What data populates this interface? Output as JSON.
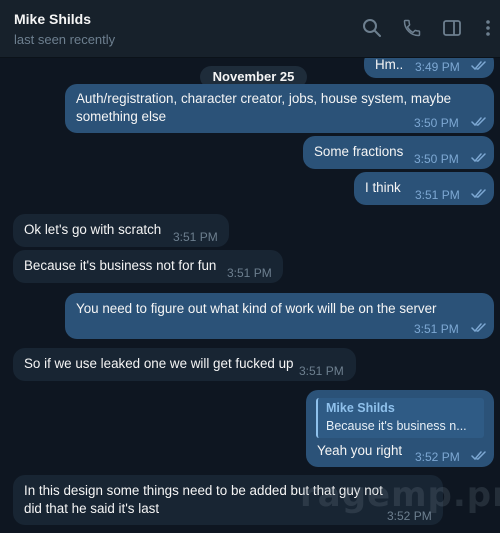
{
  "header": {
    "contact_name": "Mike Shilds",
    "status": "last seen recently"
  },
  "date_separator": "November 25",
  "messages": [
    {
      "text": "Hm..",
      "time": "3:49 PM"
    },
    {
      "text": "Auth/registration, character creator, jobs, house system, maybe something else",
      "time": "3:50 PM"
    },
    {
      "text": "Some fractions",
      "time": "3:50 PM"
    },
    {
      "text": "I think",
      "time": "3:51 PM"
    },
    {
      "text": "Ok let's go with scratch",
      "time": "3:51 PM"
    },
    {
      "text": "Because it's business not for fun",
      "time": "3:51 PM"
    },
    {
      "text": "You need to figure out what kind of work will be on the server",
      "time": "3:51 PM"
    },
    {
      "text": "So if we use leaked one we will get fucked up",
      "time": "3:51 PM"
    },
    {
      "text": "Yeah you right",
      "time": "3:52 PM",
      "reply_author": "Mike Shilds",
      "reply_text": "Because it's business n..."
    },
    {
      "text": "In this design some things need to be added but that guy not did that he said it's last",
      "time": "3:52 PM"
    }
  ],
  "watermark": "ragemp.pro",
  "colors": {
    "background": "#0e1621",
    "header": "#17212b",
    "outgoing_bubble": "#2b5278",
    "incoming_bubble": "#182533",
    "accent": "#7da8d3"
  },
  "icons": [
    "search-icon",
    "phone-icon",
    "sidebar-toggle-icon",
    "more-options-icon",
    "double-check-icon"
  ]
}
